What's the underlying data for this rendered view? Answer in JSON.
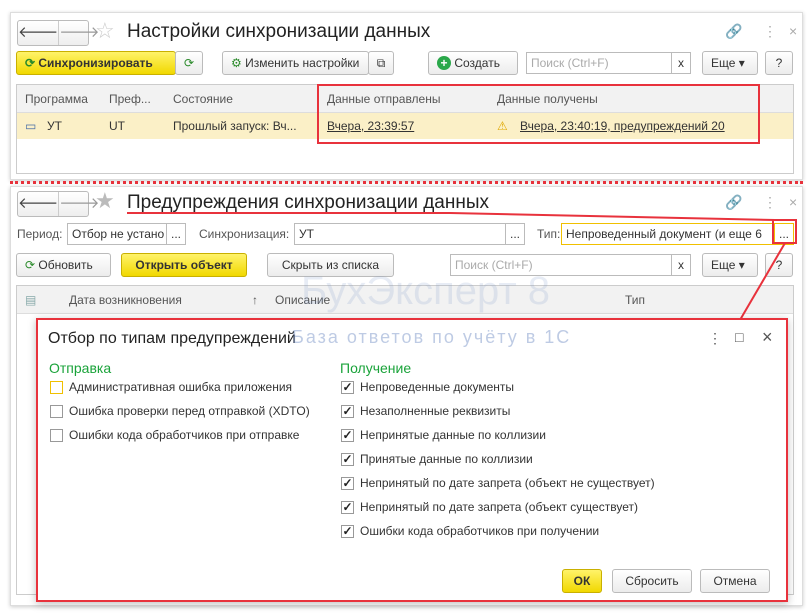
{
  "window1": {
    "title": "Настройки синхронизации данных",
    "sync_button": "Синхронизировать",
    "change_settings": "Изменить настройки",
    "create": "Создать",
    "search_placeholder": "Поиск (Ctrl+F)",
    "clear": "x",
    "more": "Еще",
    "help": "?",
    "columns": [
      "Программа",
      "Преф...",
      "Состояние",
      "Данные отправлены",
      "Данные получены"
    ],
    "row": {
      "program": "УТ",
      "prefix": "UT",
      "state": "Прошлый запуск: Вч...",
      "sent": "Вчера, 23:39:57",
      "received": "Вчера, 23:40:19, предупреждений 20"
    }
  },
  "window2": {
    "title": "Предупреждения синхронизации данных",
    "period_label": "Период:",
    "period_value": "Отбор не устано",
    "sync_label": "Синхронизация:",
    "sync_value": "УТ",
    "type_label": "Тип:",
    "type_value": "Непроведенный документ (и еще 6",
    "ellipsis": "...",
    "refresh": "Обновить",
    "open_object": "Открыть объект",
    "hide": "Скрыть из списка",
    "search_placeholder": "Поиск (Ctrl+F)",
    "clear": "x",
    "more": "Еще",
    "help": "?",
    "columns": [
      "Дата возникновения",
      "Описание",
      "Тип"
    ],
    "sort_indicator": "↑",
    "watermark": "БухЭксперт 8",
    "watermark_sub": "База ответов по учёту в 1С"
  },
  "dialog": {
    "title": "Отбор по типам предупреждений",
    "ok": "ОК",
    "reset": "Сбросить",
    "cancel": "Отмена",
    "sending_title": "Отправка",
    "sending": [
      {
        "label": "Административная ошибка приложения",
        "checked": false
      },
      {
        "label": "Ошибка проверки перед отправкой (XDTO)",
        "checked": false
      },
      {
        "label": "Ошибки кода обработчиков при отправке",
        "checked": false
      }
    ],
    "receiving_title": "Получение",
    "receiving": [
      {
        "label": "Непроведенные документы",
        "checked": true
      },
      {
        "label": "Незаполненные реквизиты",
        "checked": true
      },
      {
        "label": "Непринятые данные по коллизии",
        "checked": true
      },
      {
        "label": "Принятые данные по коллизии",
        "checked": true
      },
      {
        "label": "Непринятый по дате запрета (объект не существует)",
        "checked": true
      },
      {
        "label": "Непринятый по дате запрета (объект существует)",
        "checked": true
      },
      {
        "label": "Ошибки кода обработчиков при получении",
        "checked": true
      }
    ]
  }
}
